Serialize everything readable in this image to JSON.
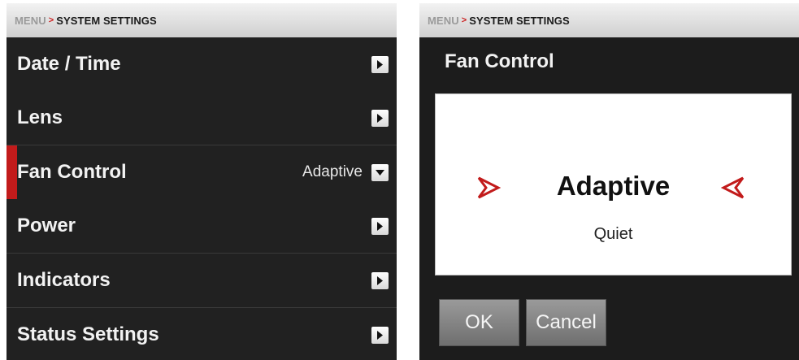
{
  "left": {
    "breadcrumb": {
      "menu": "MENU",
      "separator": ">",
      "current": "SYSTEM SETTINGS"
    },
    "items": [
      {
        "label": "Date / Time",
        "value": "",
        "control": "chevron-right"
      },
      {
        "label": "Lens",
        "value": "",
        "control": "chevron-right"
      },
      {
        "label": "Fan Control",
        "value": "Adaptive",
        "control": "chevron-down",
        "selected": true
      },
      {
        "label": "Power",
        "value": "",
        "control": "chevron-right"
      },
      {
        "label": "Indicators",
        "value": "",
        "control": "chevron-right"
      },
      {
        "label": "Status Settings",
        "value": "",
        "control": "chevron-right"
      }
    ]
  },
  "right": {
    "breadcrumb": {
      "menu": "MENU",
      "separator": ">",
      "current": "SYSTEM SETTINGS"
    },
    "title": "Fan Control",
    "picker": {
      "current_value": "Adaptive",
      "next_value": "Quiet",
      "prev_icon": "chevron-right-outline-icon",
      "next_icon": "chevron-left-outline-icon"
    },
    "buttons": {
      "ok": "OK",
      "cancel": "Cancel"
    }
  },
  "colors": {
    "accent": "#c21b1b",
    "panel_bg": "#1c1c1c",
    "row_bg": "#212121",
    "breadcrumb_bg": "#e0e0e0",
    "button_bg": "#8a8a8a"
  }
}
